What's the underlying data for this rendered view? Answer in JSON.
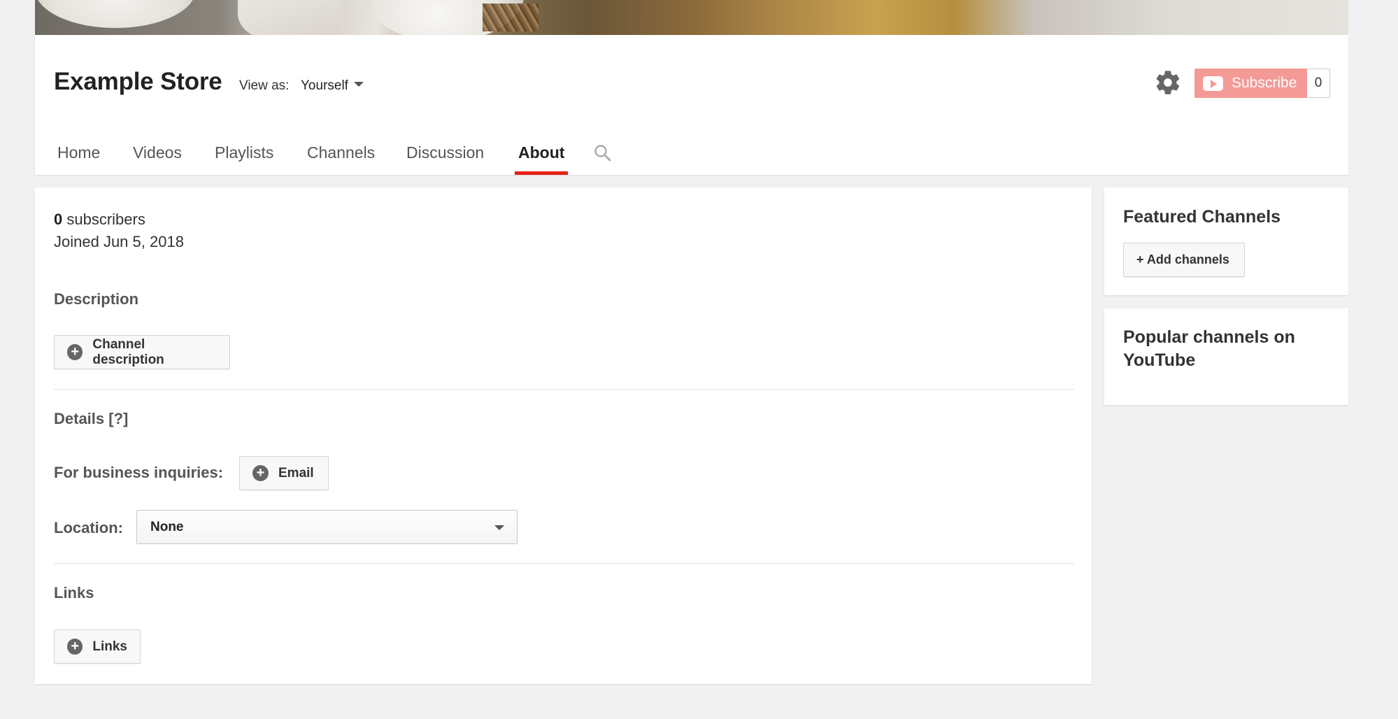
{
  "channel": {
    "title": "Example Store",
    "view_as_label": "View as:",
    "view_as_value": "Yourself"
  },
  "subscribe": {
    "label": "Subscribe",
    "count": "0"
  },
  "tabs": [
    {
      "label": "Home"
    },
    {
      "label": "Videos"
    },
    {
      "label": "Playlists"
    },
    {
      "label": "Channels"
    },
    {
      "label": "Discussion"
    },
    {
      "label": "About",
      "active": true
    }
  ],
  "about": {
    "subscriber_count": "0",
    "subscribers_label": "subscribers",
    "joined": "Joined Jun 5, 2018",
    "description_heading": "Description",
    "description_button": "Channel description",
    "details_heading": "Details [?]",
    "business_label": "For business inquiries:",
    "email_button": "Email",
    "location_label": "Location:",
    "location_value": "None",
    "links_heading": "Links",
    "links_button": "Links"
  },
  "sidebar": {
    "featured_title": "Featured Channels",
    "add_channels_button": "+ Add channels",
    "popular_title": "Popular channels on YouTube"
  },
  "colors": {
    "subscribe_bg": "#f39a96",
    "active_tab_underline": "#e62117",
    "page_bg": "#f1f1f1"
  },
  "icons": [
    "gear-icon",
    "youtube-play-icon",
    "search-icon",
    "plus-circle-icon",
    "chevron-down-icon"
  ]
}
